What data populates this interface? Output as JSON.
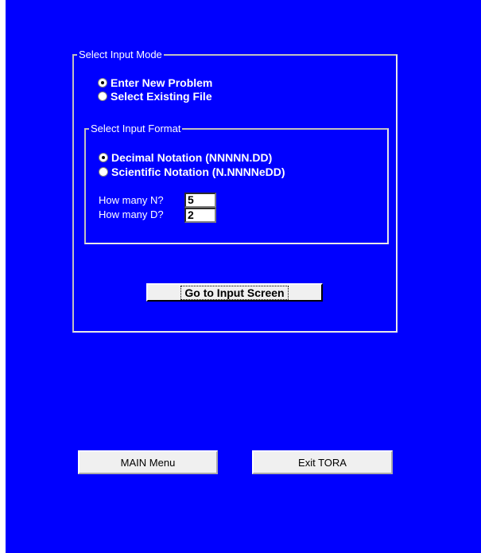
{
  "input_mode": {
    "legend": "Select Input Mode",
    "options": [
      {
        "label": "Enter New Problem",
        "selected": true
      },
      {
        "label": "Select Existing File",
        "selected": false
      }
    ]
  },
  "input_format": {
    "legend": "Select Input Format",
    "options": [
      {
        "label": "Decimal Notation (NNNNN.DD)",
        "selected": true
      },
      {
        "label": "Scientific Notation (N.NNNNeDD)",
        "selected": false
      }
    ],
    "n_label": "How many N?",
    "n_value": "5",
    "d_label": "How many D?",
    "d_value": "2"
  },
  "buttons": {
    "go_input": "Go to Input Screen",
    "main_menu": "MAIN Menu",
    "exit": "Exit TORA"
  },
  "colors": {
    "background": "#0000ff",
    "text": "#ffffff",
    "button_face": "#f0f0f0"
  }
}
